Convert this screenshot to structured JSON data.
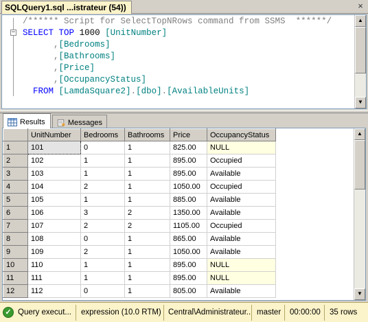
{
  "window": {
    "tab_title": "SQLQuery1.sql ...istrateur (54))",
    "close_glyph": "×"
  },
  "editor": {
    "fold_glyph": "−",
    "lines": {
      "comment": "/****** Script for SelectTopNRows command from SSMS  ******/",
      "select_kw": "SELECT",
      "top_kw": "TOP",
      "top_num": "1000",
      "col1": "[UnitNumber]",
      "col2": "[Bedrooms]",
      "col3": "[Bathrooms]",
      "col4": "[Price]",
      "col5": "[OccupancyStatus]",
      "from_kw": "FROM",
      "table_db": "[LamdaSquare2]",
      "table_schema": "[dbo]",
      "table_name": "[AvailableUnits]",
      "comma": ",",
      "dot": "."
    }
  },
  "result_tabs": {
    "results": "Results",
    "messages": "Messages"
  },
  "grid": {
    "columns": [
      "UnitNumber",
      "Bedrooms",
      "Bathrooms",
      "Price",
      "OccupancyStatus"
    ],
    "rows": [
      {
        "n": "1",
        "unit": "101",
        "bed": "0",
        "bath": "1",
        "price": "825.00",
        "status": "NULL"
      },
      {
        "n": "2",
        "unit": "102",
        "bed": "1",
        "bath": "1",
        "price": "895.00",
        "status": "Occupied"
      },
      {
        "n": "3",
        "unit": "103",
        "bed": "1",
        "bath": "1",
        "price": "895.00",
        "status": "Available"
      },
      {
        "n": "4",
        "unit": "104",
        "bed": "2",
        "bath": "1",
        "price": "1050.00",
        "status": "Occupied"
      },
      {
        "n": "5",
        "unit": "105",
        "bed": "1",
        "bath": "1",
        "price": "885.00",
        "status": "Available"
      },
      {
        "n": "6",
        "unit": "106",
        "bed": "3",
        "bath": "2",
        "price": "1350.00",
        "status": "Available"
      },
      {
        "n": "7",
        "unit": "107",
        "bed": "2",
        "bath": "2",
        "price": "1105.00",
        "status": "Occupied"
      },
      {
        "n": "8",
        "unit": "108",
        "bed": "0",
        "bath": "1",
        "price": "865.00",
        "status": "Available"
      },
      {
        "n": "9",
        "unit": "109",
        "bed": "2",
        "bath": "1",
        "price": "1050.00",
        "status": "Available"
      },
      {
        "n": "10",
        "unit": "110",
        "bed": "1",
        "bath": "1",
        "price": "895.00",
        "status": "NULL"
      },
      {
        "n": "11",
        "unit": "111",
        "bed": "1",
        "bath": "1",
        "price": "895.00",
        "status": "NULL"
      },
      {
        "n": "12",
        "unit": "112",
        "bed": "0",
        "bath": "1",
        "price": "805.00",
        "status": "Available"
      }
    ]
  },
  "statusbar": {
    "ok_glyph": "✓",
    "query_status": "Query execut...",
    "server": "expression (10.0 RTM)",
    "login": "Central\\Administrateur...",
    "database": "master",
    "elapsed": "00:00:00",
    "rows": "35 rows"
  },
  "colors": {
    "keyword": "#0000ff",
    "keyword_red": "#ff0000",
    "comment": "#808080",
    "identifier": "#008080",
    "null_cell": "#ffffe1",
    "statusbar_bg": "#fbf3c9"
  }
}
